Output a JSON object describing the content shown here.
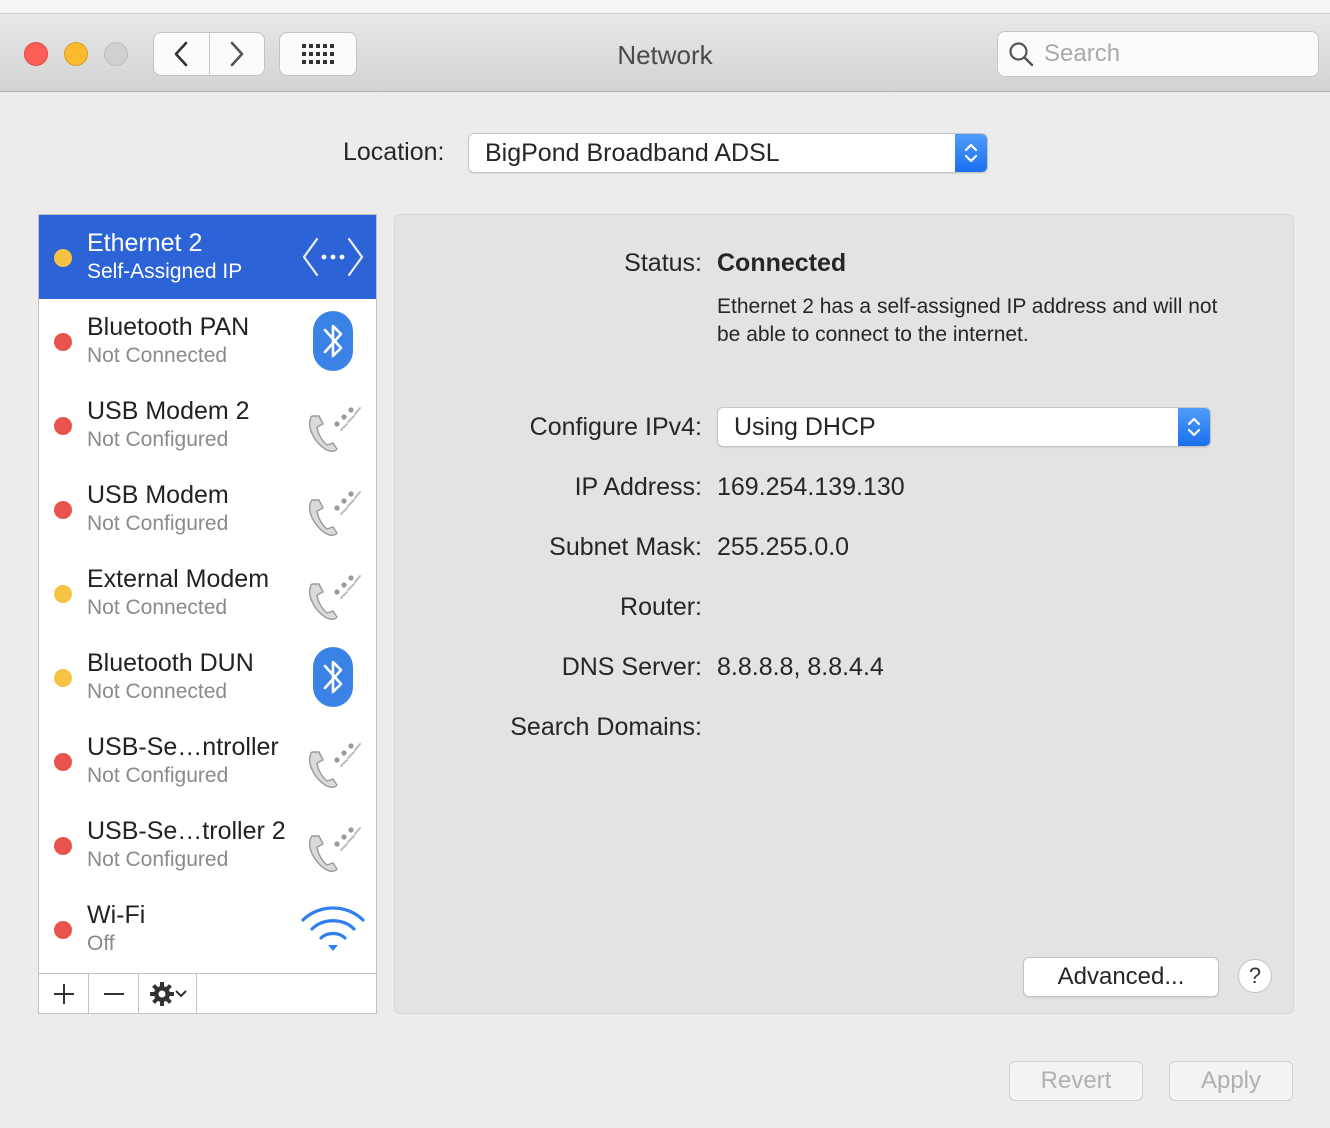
{
  "window": {
    "title": "Network",
    "search_placeholder": "Search"
  },
  "location": {
    "label": "Location:",
    "value": "BigPond Broadband ADSL"
  },
  "services": [
    {
      "name": "Ethernet 2",
      "status": "Self-Assigned IP",
      "dot": "yellow",
      "icon": "ethernet-icon",
      "selected": true
    },
    {
      "name": "Bluetooth PAN",
      "status": "Not Connected",
      "dot": "red",
      "icon": "bluetooth-icon"
    },
    {
      "name": "USB Modem 2",
      "status": "Not Configured",
      "dot": "red",
      "icon": "phone-icon"
    },
    {
      "name": "USB Modem",
      "status": "Not Configured",
      "dot": "red",
      "icon": "phone-icon"
    },
    {
      "name": "External Modem",
      "status": "Not Connected",
      "dot": "yellow",
      "icon": "phone-icon"
    },
    {
      "name": "Bluetooth DUN",
      "status": "Not Connected",
      "dot": "yellow",
      "icon": "bluetooth-icon"
    },
    {
      "name": "USB-Se…ntroller",
      "status": "Not Configured",
      "dot": "red",
      "icon": "phone-icon"
    },
    {
      "name": "USB-Se…troller 2",
      "status": "Not Configured",
      "dot": "red",
      "icon": "phone-icon"
    },
    {
      "name": "Wi-Fi",
      "status": "Off",
      "dot": "red",
      "icon": "wifi-icon"
    }
  ],
  "detail": {
    "status_label": "Status:",
    "status_value": "Connected",
    "status_description": "Ethernet 2 has a self-assigned IP address and will not be able to connect to the internet.",
    "configure_label": "Configure IPv4:",
    "configure_value": "Using DHCP",
    "ip_label": "IP Address:",
    "ip_value": "169.254.139.130",
    "subnet_label": "Subnet Mask:",
    "subnet_value": "255.255.0.0",
    "router_label": "Router:",
    "router_value": "",
    "dns_label": "DNS Server:",
    "dns_value": "8.8.8.8, 8.8.4.4",
    "search_domains_label": "Search Domains:",
    "search_domains_value": "",
    "advanced_label": "Advanced...",
    "help_label": "?"
  },
  "footer": {
    "revert_label": "Revert",
    "apply_label": "Apply"
  },
  "colors": {
    "selection": "#2c63d6",
    "status_red": "#e9534e",
    "status_yellow": "#f6c244",
    "accent_blue": "#1b6ff0"
  }
}
